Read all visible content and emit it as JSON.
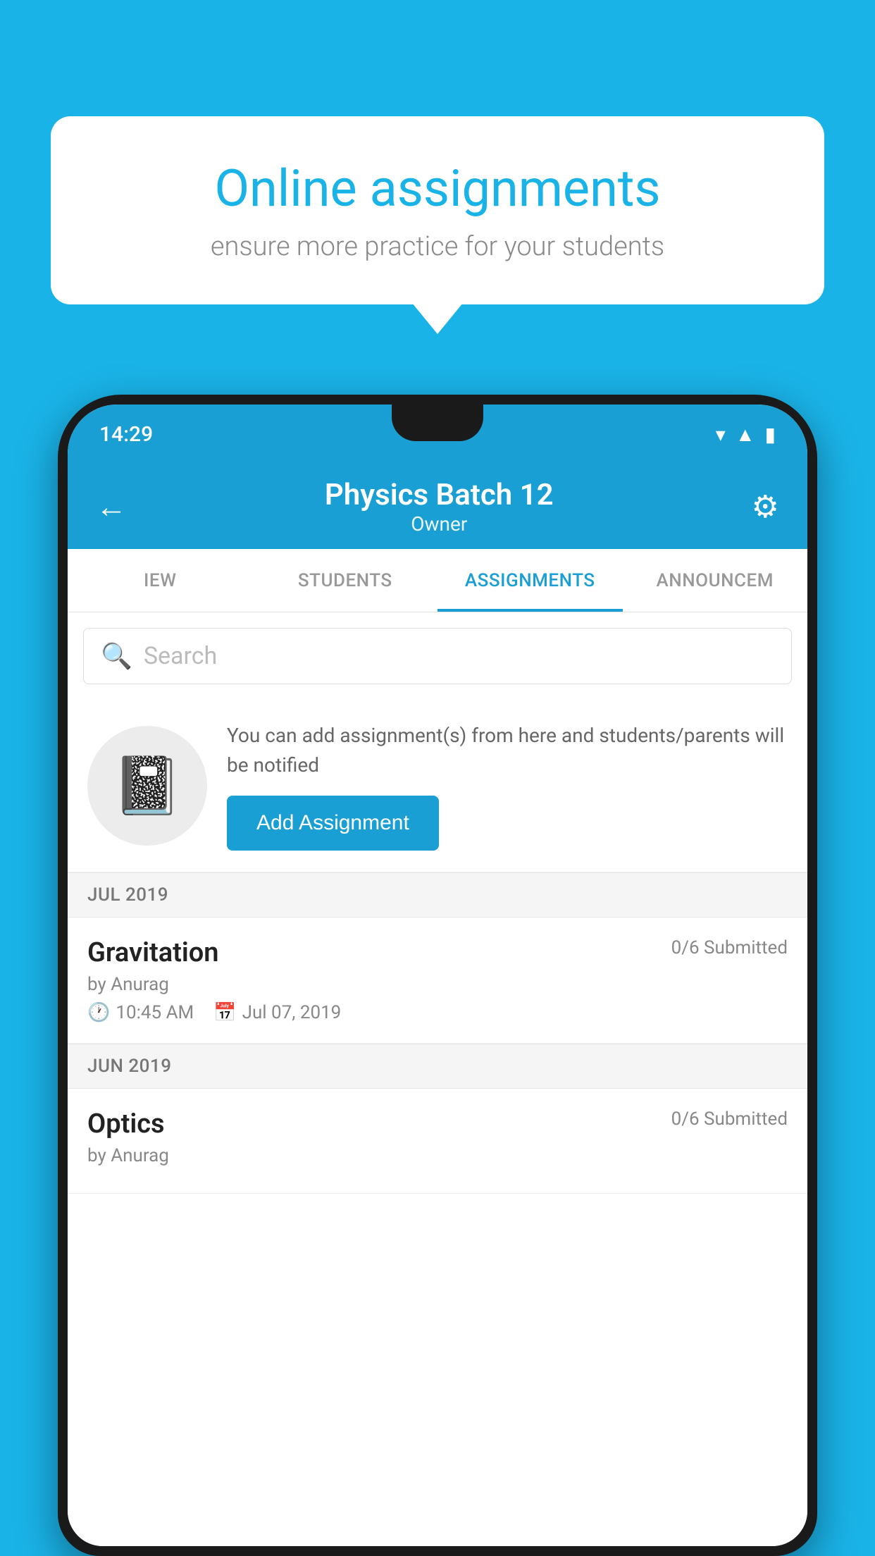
{
  "background_color": "#1ab3e8",
  "speech_bubble": {
    "title": "Online assignments",
    "subtitle": "ensure more practice for your students"
  },
  "phone": {
    "status_bar": {
      "time": "14:29",
      "icons": [
        "wifi",
        "signal",
        "battery"
      ]
    },
    "header": {
      "title": "Physics Batch 12",
      "subtitle": "Owner",
      "back_label": "←",
      "settings_label": "⚙"
    },
    "tabs": [
      {
        "label": "IEW",
        "active": false
      },
      {
        "label": "STUDENTS",
        "active": false
      },
      {
        "label": "ASSIGNMENTS",
        "active": true
      },
      {
        "label": "ANNOUNCEM",
        "active": false
      }
    ],
    "search": {
      "placeholder": "Search"
    },
    "promo": {
      "description": "You can add assignment(s) from here and students/parents will be notified",
      "button_label": "Add Assignment"
    },
    "assignments": [
      {
        "section": "JUL 2019",
        "items": [
          {
            "name": "Gravitation",
            "submitted": "0/6 Submitted",
            "by": "by Anurag",
            "time": "10:45 AM",
            "date": "Jul 07, 2019"
          }
        ]
      },
      {
        "section": "JUN 2019",
        "items": [
          {
            "name": "Optics",
            "submitted": "0/6 Submitted",
            "by": "by Anurag",
            "time": "",
            "date": ""
          }
        ]
      }
    ]
  }
}
